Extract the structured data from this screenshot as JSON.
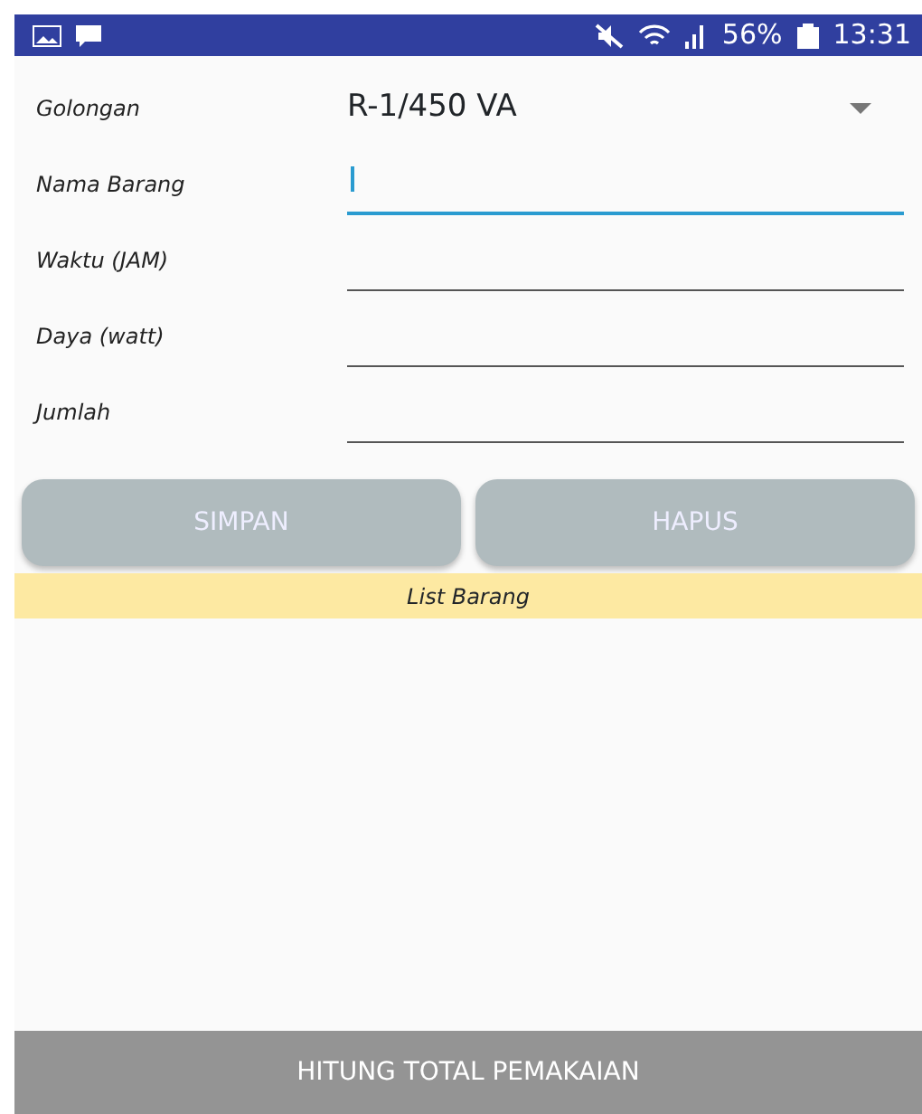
{
  "status_bar": {
    "battery": "56%",
    "time": "13:31"
  },
  "form": {
    "dropdown": {
      "label": "Golongan",
      "value": "R-1/450 VA"
    },
    "fields": [
      {
        "label": "Nama Barang",
        "focused": true
      },
      {
        "label": "Waktu (JAM)",
        "focused": false
      },
      {
        "label": "Daya (watt)",
        "focused": false
      },
      {
        "label": "Jumlah",
        "focused": false
      }
    ]
  },
  "buttons": [
    {
      "label": "SIMPAN"
    },
    {
      "label": "HAPUS"
    }
  ],
  "list_header": "List Barang",
  "bottom_button": "HITUNG TOTAL PEMAKAIAN"
}
